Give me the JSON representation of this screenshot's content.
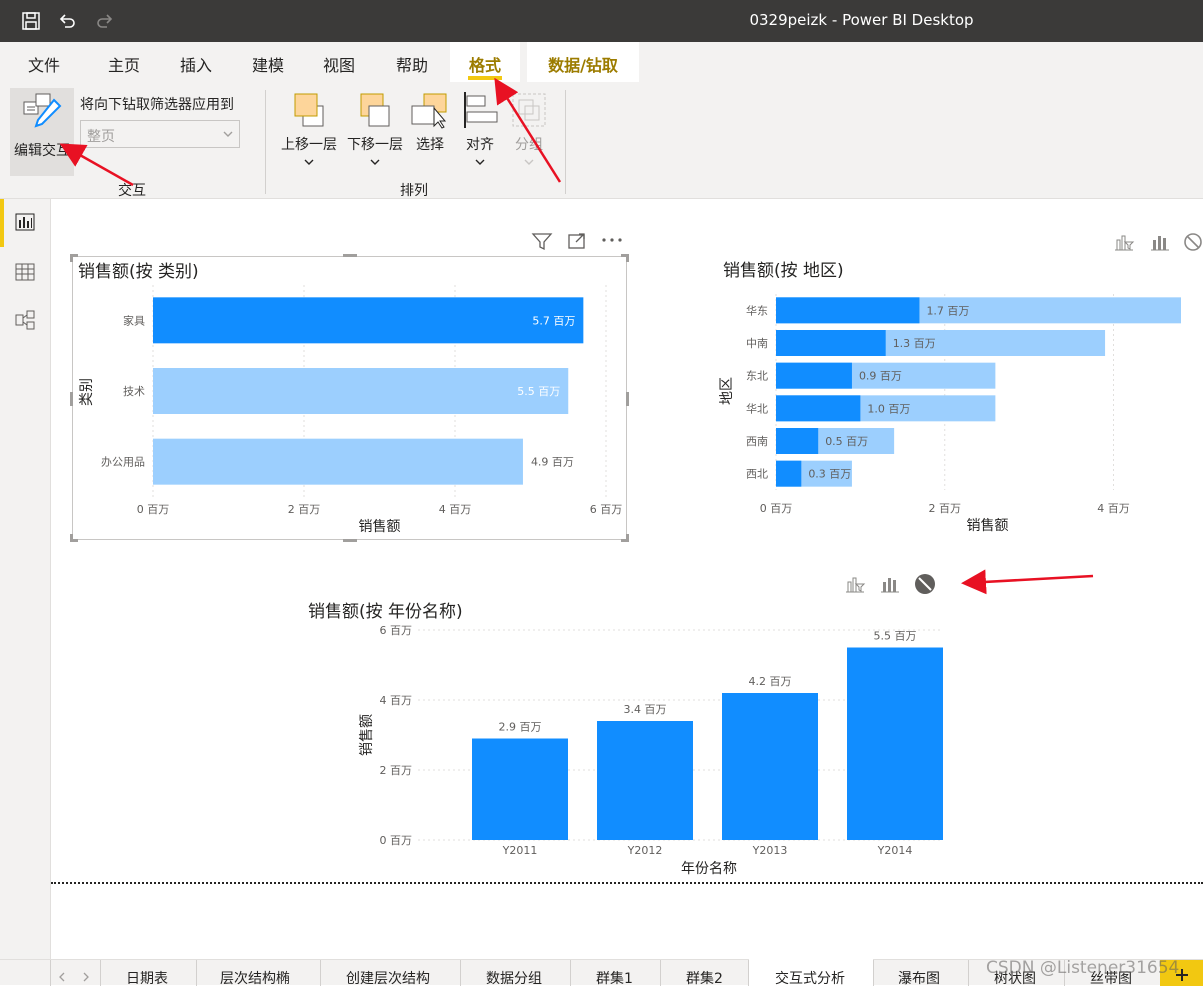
{
  "window": {
    "title": "0329peizk - Power BI Desktop"
  },
  "quick_access": [
    "save-icon",
    "undo-icon",
    "redo-icon"
  ],
  "ribbon_tabs": [
    {
      "label": "文件"
    },
    {
      "label": "主页"
    },
    {
      "label": "插入"
    },
    {
      "label": "建模"
    },
    {
      "label": "视图"
    },
    {
      "label": "帮助"
    },
    {
      "label": "格式",
      "active": true
    },
    {
      "label": "数据/钻取"
    }
  ],
  "ribbon": {
    "edit_interactions": "编辑交互",
    "drill_label": "将向下钻取筛选器应用到",
    "drill_select": "整页",
    "interaction_group": "交互",
    "bring_forward": "上移一层",
    "send_backward": "下移一层",
    "select": "选择",
    "align": "对齐",
    "group": "分组",
    "arrange_group": "排列"
  },
  "colors": {
    "accent": "#118dff",
    "light": "#9ccffe",
    "yellow": "#f2c811",
    "red_annotation": "#e81123"
  },
  "visuals": [
    {
      "title": "销售额(按 类别)",
      "chart_data": {
        "type": "bar",
        "orientation": "horizontal",
        "categories": [
          "家具",
          "技术",
          "办公用品"
        ],
        "values": [
          5.7,
          5.5,
          4.9
        ],
        "data_labels": [
          "5.7 百万",
          "5.5 百万",
          "4.9 百万"
        ],
        "xlabel": "销售额",
        "ylabel": "类别",
        "xticks": [
          "0 百万",
          "2 百万",
          "4 百万",
          "6 百万"
        ],
        "xlim": [
          0,
          6
        ]
      }
    },
    {
      "title": "销售额(按 地区)",
      "chart_data": {
        "type": "bar",
        "orientation": "horizontal",
        "categories": [
          "华东",
          "中南",
          "东北",
          "华北",
          "西南",
          "西北"
        ],
        "series": [
          {
            "values": [
              1.7,
              1.3,
              0.9,
              1.0,
              0.5,
              0.3
            ]
          },
          {
            "values": [
              4.8,
              3.9,
              2.6,
              2.6,
              1.4,
              0.9
            ]
          }
        ],
        "data_labels": [
          "1.7 百万",
          "1.3 百万",
          "0.9 百万",
          "1.0 百万",
          "0.5 百万",
          "0.3 百万"
        ],
        "xlabel": "销售额",
        "ylabel": "地区",
        "xticks": [
          "0 百万",
          "2 百万",
          "4 百万"
        ],
        "xlim": [
          0,
          4.8
        ]
      }
    },
    {
      "title": "销售额(按 年份名称)",
      "chart_data": {
        "type": "bar",
        "orientation": "vertical",
        "categories": [
          "Y2011",
          "Y2012",
          "Y2013",
          "Y2014"
        ],
        "values": [
          2.9,
          3.4,
          4.2,
          5.5
        ],
        "data_labels": [
          "2.9 百万",
          "3.4 百万",
          "4.2 百万",
          "5.5 百万"
        ],
        "xlabel": "年份名称",
        "ylabel": "销售额",
        "yticks": [
          "0 百万",
          "2 百万",
          "4 百万",
          "6 百万"
        ],
        "ylim": [
          0,
          6
        ]
      }
    }
  ],
  "page_tabs": [
    "日期表",
    "层次结构椭",
    "创建层次结构",
    "数据分组",
    "群集1",
    "群集2",
    "交互式分析",
    "瀑布图",
    "树状图",
    "丝带图"
  ],
  "active_page_tab": "交互式分析",
  "watermark": "CSDN @Listener31654"
}
